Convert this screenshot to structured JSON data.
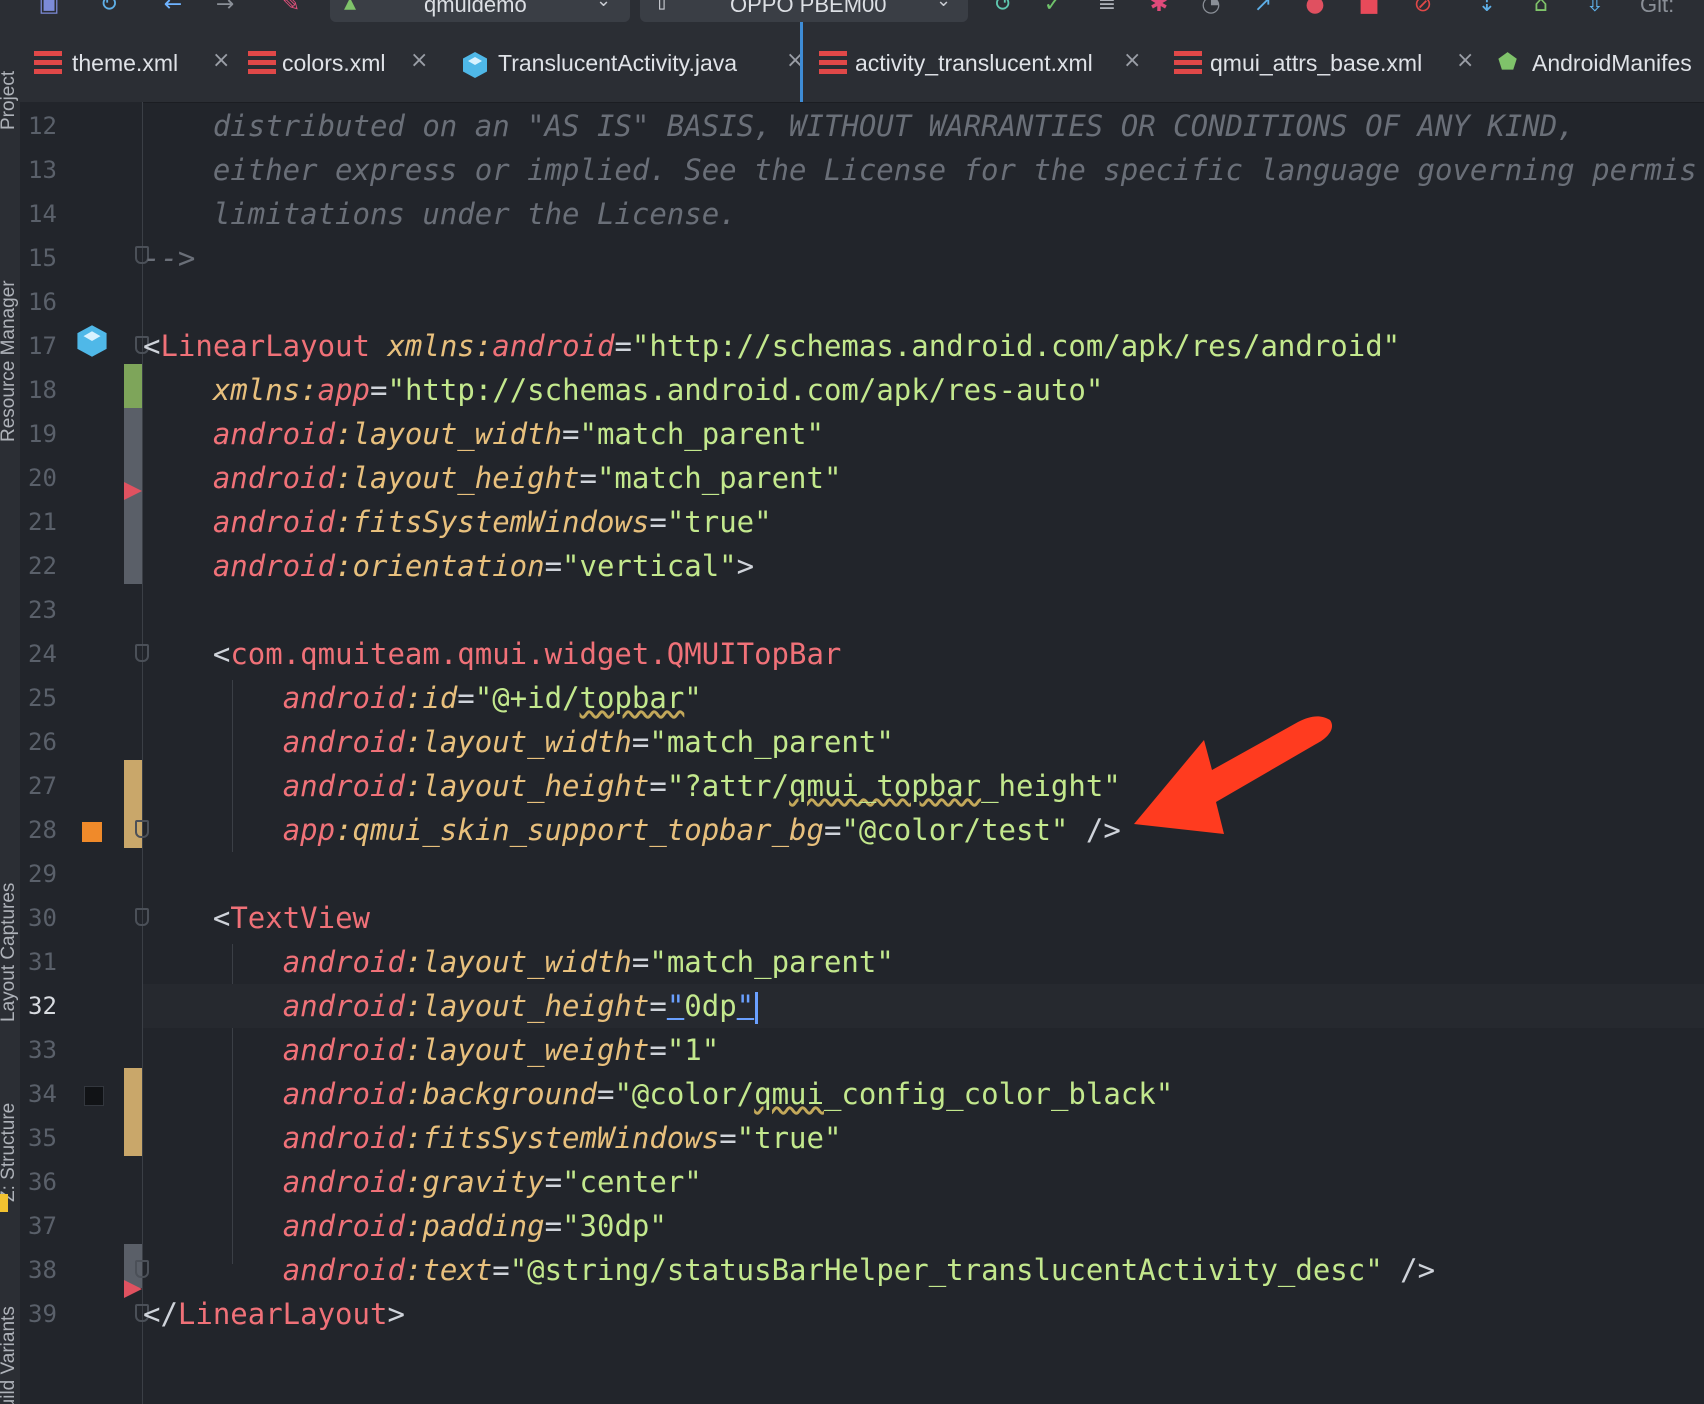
{
  "toolbar": {
    "module_combo": "qmuidemo",
    "device_combo": "OPPO PBEM00",
    "git_label": "Git:"
  },
  "tabs": [
    {
      "label": "theme.xml",
      "icon": "xml-file-icon"
    },
    {
      "label": "colors.xml",
      "icon": "xml-file-icon"
    },
    {
      "label": "TranslucentActivity.java",
      "icon": "java-class-icon"
    },
    {
      "label": "activity_translucent.xml",
      "icon": "xml-file-icon",
      "active": true
    },
    {
      "label": "qmui_attrs_base.xml",
      "icon": "xml-file-icon"
    },
    {
      "label": "AndroidManifes",
      "icon": "android-icon"
    }
  ],
  "side_panels": [
    "Project",
    "Resource Manager",
    "Layout Captures",
    "Z: Structure",
    "Build Variants"
  ],
  "editor": {
    "current_line": 32,
    "lines": [
      {
        "n": 12,
        "tokens": [
          [
            "cm",
            "    distributed on an \"AS IS\" BASIS, WITHOUT WARRANTIES OR CONDITIONS OF ANY KIND,"
          ]
        ]
      },
      {
        "n": 13,
        "tokens": [
          [
            "cm",
            "    either express or implied. See the License for the specific language governing permis"
          ]
        ]
      },
      {
        "n": 14,
        "tokens": [
          [
            "cm",
            "    limitations under the License."
          ]
        ]
      },
      {
        "n": 15,
        "tokens": [
          [
            "cm",
            "-->"
          ]
        ]
      },
      {
        "n": 16,
        "tokens": []
      },
      {
        "n": 17,
        "tokens": [
          [
            "br",
            "<"
          ],
          [
            "tg",
            "LinearLayout "
          ],
          [
            "an",
            "xmlns"
          ],
          [
            "an",
            ":"
          ],
          [
            "ns",
            "android"
          ],
          [
            "eq",
            "="
          ],
          [
            "st",
            "\"http://schemas.android.com/apk/res/android\""
          ]
        ]
      },
      {
        "n": 18,
        "tokens": [
          [
            "br",
            "    "
          ],
          [
            "an",
            "xmlns"
          ],
          [
            "an",
            ":"
          ],
          [
            "ns",
            "app"
          ],
          [
            "eq",
            "="
          ],
          [
            "st",
            "\"http://schemas.android.com/apk/res-auto\""
          ]
        ]
      },
      {
        "n": 19,
        "tokens": [
          [
            "br",
            "    "
          ],
          [
            "ns",
            "android"
          ],
          [
            "an",
            ":layout_width"
          ],
          [
            "eq",
            "="
          ],
          [
            "st",
            "\"match_parent\""
          ]
        ]
      },
      {
        "n": 20,
        "tokens": [
          [
            "br",
            "    "
          ],
          [
            "ns",
            "android"
          ],
          [
            "an",
            ":layout_height"
          ],
          [
            "eq",
            "="
          ],
          [
            "st",
            "\"match_parent\""
          ]
        ]
      },
      {
        "n": 21,
        "tokens": [
          [
            "br",
            "    "
          ],
          [
            "ns",
            "android"
          ],
          [
            "an",
            ":fitsSystemWindows"
          ],
          [
            "eq",
            "="
          ],
          [
            "st",
            "\"true\""
          ]
        ]
      },
      {
        "n": 22,
        "tokens": [
          [
            "br",
            "    "
          ],
          [
            "ns",
            "android"
          ],
          [
            "an",
            ":orientation"
          ],
          [
            "eq",
            "="
          ],
          [
            "st",
            "\"vertical\""
          ],
          [
            "br",
            ">"
          ]
        ]
      },
      {
        "n": 23,
        "tokens": []
      },
      {
        "n": 24,
        "tokens": [
          [
            "br",
            "    <"
          ],
          [
            "tg",
            "com.qmuiteam.qmui.widget.QMUITopBar"
          ]
        ]
      },
      {
        "n": 25,
        "tokens": [
          [
            "br",
            "        "
          ],
          [
            "ns",
            "android"
          ],
          [
            "an",
            ":id"
          ],
          [
            "eq",
            "="
          ],
          [
            "st",
            "\"@+id/"
          ],
          [
            "stw",
            "topbar"
          ],
          [
            "st",
            "\""
          ]
        ]
      },
      {
        "n": 26,
        "tokens": [
          [
            "br",
            "        "
          ],
          [
            "ns",
            "android"
          ],
          [
            "an",
            ":layout_width"
          ],
          [
            "eq",
            "="
          ],
          [
            "st",
            "\"match_parent\""
          ]
        ]
      },
      {
        "n": 27,
        "tokens": [
          [
            "br",
            "        "
          ],
          [
            "ns",
            "android"
          ],
          [
            "an",
            ":layout_height"
          ],
          [
            "eq",
            "="
          ],
          [
            "st",
            "\"?attr/"
          ],
          [
            "stw",
            "qmui_topbar"
          ],
          [
            "st",
            "_height\""
          ]
        ]
      },
      {
        "n": 28,
        "tokens": [
          [
            "br",
            "        "
          ],
          [
            "ns",
            "app"
          ],
          [
            "an",
            ":qmui_skin_support_topbar_bg"
          ],
          [
            "eq",
            "="
          ],
          [
            "st",
            "\"@color/test\""
          ],
          [
            "br",
            " />"
          ]
        ]
      },
      {
        "n": 29,
        "tokens": []
      },
      {
        "n": 30,
        "tokens": [
          [
            "br",
            "    <"
          ],
          [
            "tg",
            "TextView"
          ]
        ]
      },
      {
        "n": 31,
        "tokens": [
          [
            "br",
            "        "
          ],
          [
            "ns",
            "android"
          ],
          [
            "an",
            ":layout_width"
          ],
          [
            "eq",
            "="
          ],
          [
            "st",
            "\"match_parent\""
          ]
        ]
      },
      {
        "n": 32,
        "tokens": [
          [
            "br",
            "        "
          ],
          [
            "ns",
            "android"
          ],
          [
            "an",
            ":layout_height"
          ],
          [
            "eq",
            "="
          ],
          [
            "sel",
            "\""
          ],
          [
            "st",
            "0dp"
          ],
          [
            "sel",
            "\""
          ],
          [
            "caret",
            ""
          ]
        ]
      },
      {
        "n": 33,
        "tokens": [
          [
            "br",
            "        "
          ],
          [
            "ns",
            "android"
          ],
          [
            "an",
            ":layout_weight"
          ],
          [
            "eq",
            "="
          ],
          [
            "st",
            "\"1\""
          ]
        ]
      },
      {
        "n": 34,
        "tokens": [
          [
            "br",
            "        "
          ],
          [
            "ns",
            "android"
          ],
          [
            "an",
            ":background"
          ],
          [
            "eq",
            "="
          ],
          [
            "st",
            "\"@color/"
          ],
          [
            "stw",
            "qmui"
          ],
          [
            "st",
            "_config_color_black\""
          ]
        ]
      },
      {
        "n": 35,
        "tokens": [
          [
            "br",
            "        "
          ],
          [
            "ns",
            "android"
          ],
          [
            "an",
            ":fitsSystemWindows"
          ],
          [
            "eq",
            "="
          ],
          [
            "st",
            "\"true\""
          ]
        ]
      },
      {
        "n": 36,
        "tokens": [
          [
            "br",
            "        "
          ],
          [
            "ns",
            "android"
          ],
          [
            "an",
            ":gravity"
          ],
          [
            "eq",
            "="
          ],
          [
            "st",
            "\"center\""
          ]
        ]
      },
      {
        "n": 37,
        "tokens": [
          [
            "br",
            "        "
          ],
          [
            "ns",
            "android"
          ],
          [
            "an",
            ":padding"
          ],
          [
            "eq",
            "="
          ],
          [
            "st",
            "\"30dp\""
          ]
        ]
      },
      {
        "n": 38,
        "tokens": [
          [
            "br",
            "        "
          ],
          [
            "ns",
            "android"
          ],
          [
            "an",
            ":text"
          ],
          [
            "eq",
            "="
          ],
          [
            "st",
            "\"@string/statusBarHelper_translucentActivity_desc\""
          ],
          [
            "br",
            " />"
          ]
        ]
      },
      {
        "n": 39,
        "tokens": [
          [
            "br",
            "</"
          ],
          [
            "tg",
            "LinearLayout"
          ],
          [
            "br",
            ">"
          ]
        ]
      }
    ]
  },
  "annotation": {
    "arrow_color": "#ff3b1f",
    "description_icon": "red-arrow-annotation"
  },
  "colors": {
    "tag": "#f07178",
    "string": "#c3e88d",
    "attr": "#e8c07d",
    "comment": "#6a6f78",
    "background": "#22252b"
  }
}
